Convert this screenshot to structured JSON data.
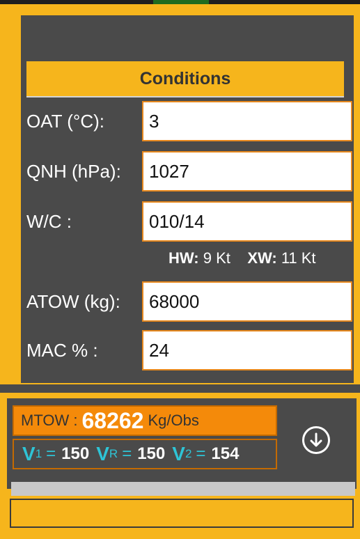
{
  "conditions": {
    "title": "Conditions",
    "oat": {
      "label": "OAT (°C):",
      "value": "3"
    },
    "qnh": {
      "label": "QNH (hPa):",
      "value": "1027"
    },
    "wc": {
      "label": "W/C :",
      "value": "010/14"
    },
    "wind_components": {
      "hw_label": "HW:",
      "hw_value": "9 Kt",
      "xw_label": "XW:",
      "xw_value": "11 Kt"
    },
    "atow": {
      "label": "ATOW (kg):",
      "value": "68000"
    },
    "mac": {
      "label": "MAC % :",
      "value": "24"
    }
  },
  "result": {
    "mtow_label": "MTOW :",
    "mtow_value": "68262",
    "mtow_unit": "Kg/Obs",
    "v1_label": "V",
    "v1_sub": "1",
    "v1_value": "150",
    "vr_label": "V",
    "vr_sub": "R",
    "vr_value": "150",
    "v2_label": "V",
    "v2_sub": "2",
    "v2_value": "154",
    "eq": "="
  },
  "icons": {
    "download": "arrow-down-circle-icon"
  },
  "colors": {
    "accent": "#f6b51c",
    "panel": "#4a4a4a",
    "mtow_bg": "#f48a0a",
    "speed_text": "#2ec4d6"
  }
}
